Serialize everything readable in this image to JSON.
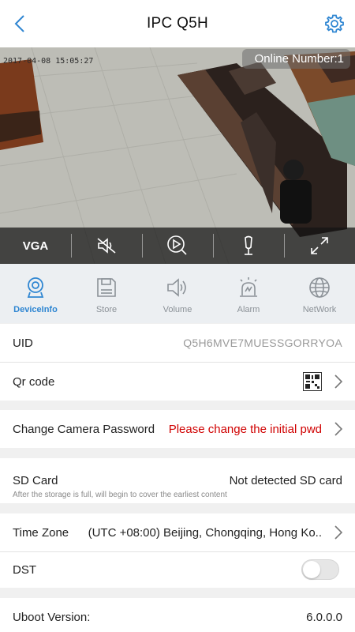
{
  "header": {
    "title": "IPC Q5H"
  },
  "video": {
    "timestamp": "2017-04-08 15:05:27",
    "online_label": "Online Number:1",
    "resolution_label": "VGA"
  },
  "tabs": [
    {
      "label": "DeviceInfo",
      "icon": "webcam-icon",
      "active": true
    },
    {
      "label": "Store",
      "icon": "floppy-disk-icon",
      "active": false
    },
    {
      "label": "Volume",
      "icon": "speaker-icon",
      "active": false
    },
    {
      "label": "Alarm",
      "icon": "alarm-light-icon",
      "active": false
    },
    {
      "label": "NetWork",
      "icon": "globe-icon",
      "active": false
    }
  ],
  "settings": {
    "uid": {
      "label": "UID",
      "value": "Q5H6MVE7MUESSGORRYOA"
    },
    "qr": {
      "label": "Qr code"
    },
    "password": {
      "label": "Change Camera Password",
      "value": "Please change the initial pwd"
    },
    "sd": {
      "label": "SD Card",
      "value": "Not detected SD card",
      "hint": "After the storage is full, will begin to cover the earliest content"
    },
    "timezone": {
      "label": "Time Zone",
      "value": "(UTC +08:00) Beijing, Chongqing, Hong Ko.."
    },
    "dst": {
      "label": "DST",
      "enabled": false
    },
    "uboot": {
      "label": "Uboot Version:",
      "value": "6.0.0.0"
    }
  },
  "colors": {
    "accent": "#2f86d2",
    "warning": "#d00000",
    "muted": "#8b9197"
  }
}
